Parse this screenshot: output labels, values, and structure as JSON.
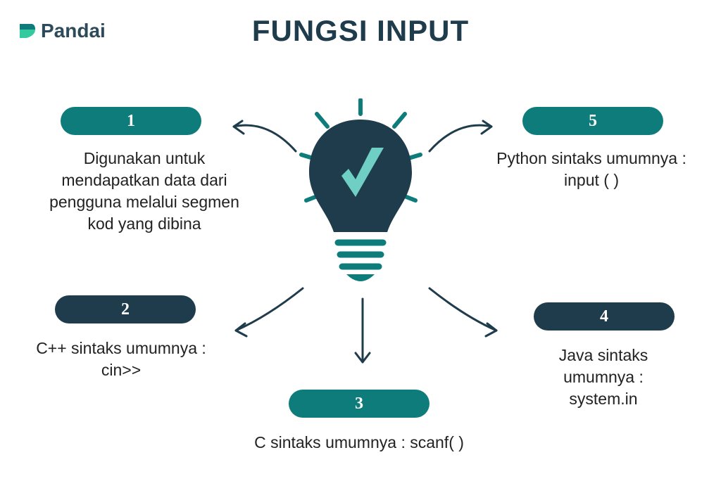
{
  "logo": {
    "word": "Pandai"
  },
  "title": "FUNGSI INPUT",
  "items": [
    {
      "num": "1",
      "text": "Digunakan untuk mendapatkan data dari pengguna melalui segmen kod yang dibina"
    },
    {
      "num": "2",
      "text": "C++ sintaks umumnya : cin>>"
    },
    {
      "num": "3",
      "text": "C sintaks umumnya : scanf( )"
    },
    {
      "num": "4",
      "text": "Java sintaks umumnya : system.in"
    },
    {
      "num": "5",
      "text": "Python sintaks umumnya : input ( )"
    }
  ],
  "colors": {
    "teal": "#0e7c7b",
    "navy": "#1f3c4c"
  }
}
